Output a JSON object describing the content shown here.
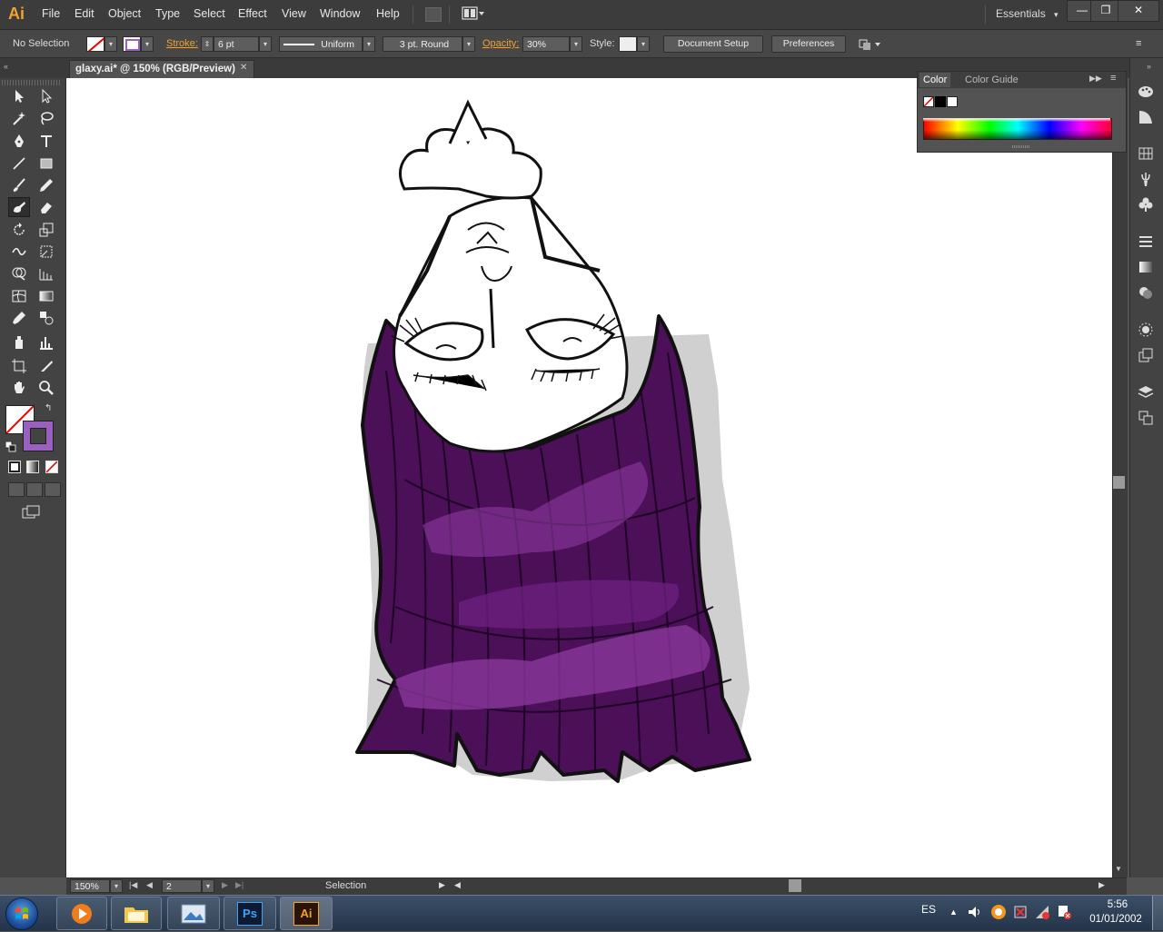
{
  "app": {
    "logo": "Ai"
  },
  "menu": [
    "File",
    "Edit",
    "Object",
    "Type",
    "Select",
    "Effect",
    "View",
    "Window",
    "Help"
  ],
  "workspace": {
    "label": "Essentials",
    "arrow": "▾"
  },
  "window_controls": {
    "minimize": "—",
    "restore": "❐",
    "close": "✕"
  },
  "control": {
    "selection_status": "No Selection",
    "stroke_label": "Stroke:",
    "stroke_value": "6 pt",
    "profile_value": "Uniform",
    "brush_value": "3 pt. Round",
    "opacity_label": "Opacity:",
    "opacity_value": "30%",
    "style_label": "Style:",
    "document_setup": "Document Setup",
    "preferences": "Preferences"
  },
  "document_tab": {
    "title": "glaxy.ai* @ 150% (RGB/Preview)",
    "close": "✕"
  },
  "status": {
    "zoom": "150%",
    "artboard": "2",
    "tool": "Selection"
  },
  "color_panel": {
    "tab_color": "Color",
    "tab_guide": "Color Guide"
  },
  "colors": {
    "fill_stroke_purple": "#9a5fbf",
    "hair_dark": "#3a0a45",
    "hair_mid": "#5b1670",
    "hair_light": "#8e3aa0",
    "accent_orange": "#f3a22c"
  },
  "taskbar": {
    "apps": [
      "media-player-icon",
      "explorer-icon",
      "photo-viewer-icon",
      "photoshop-icon",
      "illustrator-icon"
    ],
    "ps_label": "Ps",
    "ai_label": "Ai",
    "language": "ES",
    "time": "5:56",
    "date": "01/01/2002"
  },
  "tools": [
    "selection-tool",
    "direct-selection-tool",
    "magic-wand-tool",
    "lasso-tool",
    "pen-tool",
    "type-tool",
    "line-tool",
    "rectangle-tool",
    "paintbrush-tool",
    "pencil-tool",
    "blob-brush-tool",
    "eraser-tool",
    "rotate-tool",
    "scale-tool",
    "warp-tool",
    "free-transform-tool",
    "shape-builder-tool",
    "perspective-grid-tool",
    "mesh-tool",
    "gradient-tool",
    "eyedropper-tool",
    "blend-tool",
    "symbol-sprayer-tool",
    "column-graph-tool",
    "artboard-tool",
    "slice-tool",
    "hand-tool",
    "zoom-tool"
  ]
}
